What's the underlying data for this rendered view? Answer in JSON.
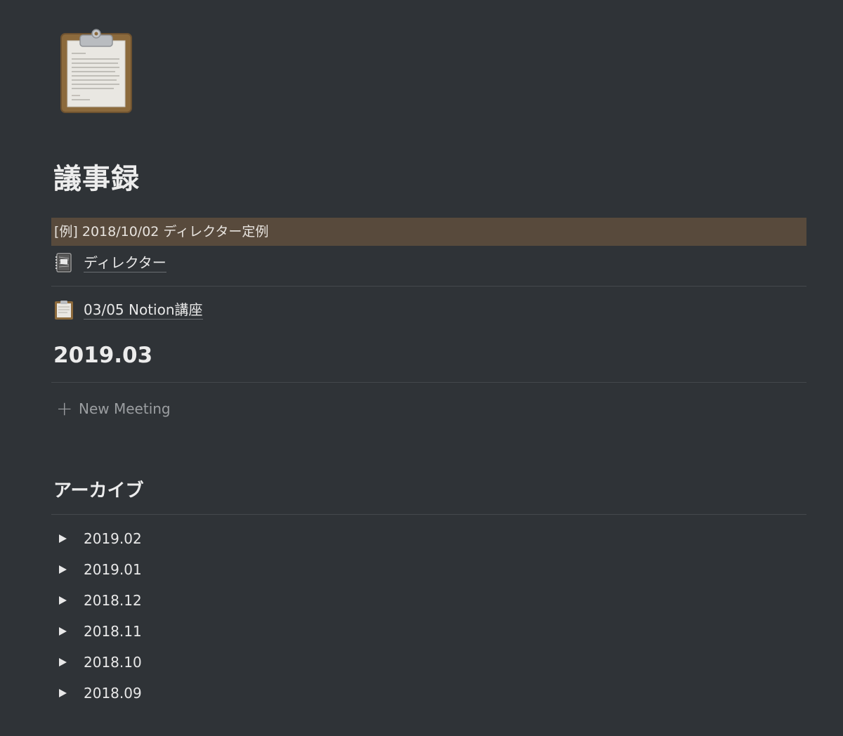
{
  "page": {
    "icon": "clipboard-icon",
    "title": "議事録"
  },
  "callout": {
    "text": "[例] 2018/10/02 ディレクター定例"
  },
  "links": [
    {
      "icon": "notebook-icon",
      "label": "ディレクター"
    },
    {
      "icon": "clipboard-icon",
      "label": "03/05 Notion講座"
    }
  ],
  "current_section": {
    "heading": "2019.03",
    "new_label": "New Meeting"
  },
  "archive": {
    "heading": "アーカイブ",
    "items": [
      {
        "label": "2019.02"
      },
      {
        "label": "2019.01"
      },
      {
        "label": "2018.12"
      },
      {
        "label": "2018.11"
      },
      {
        "label": "2018.10"
      },
      {
        "label": "2018.09"
      }
    ]
  },
  "colors": {
    "background": "#2f3337",
    "callout": "#584a3c",
    "divider": "#44484c"
  }
}
